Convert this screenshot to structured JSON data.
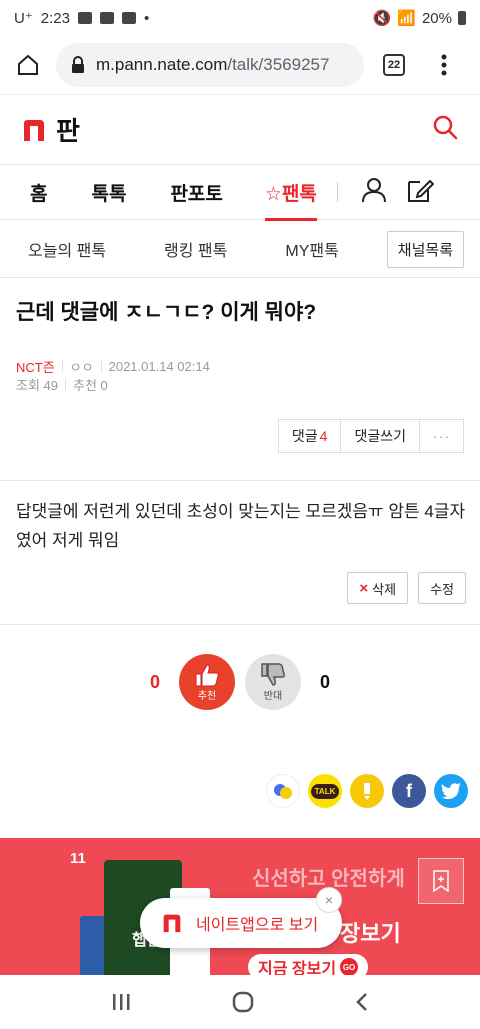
{
  "status_bar": {
    "carrier": "U⁺",
    "time": "2:23",
    "battery": "20%"
  },
  "browser": {
    "url_host": "m.pann.nate.com",
    "url_path": "/talk/3569257",
    "tab_count": "22"
  },
  "site": {
    "brand": "판",
    "accent_color": "#e8262b"
  },
  "main_nav": {
    "items": [
      "홈",
      "톡톡",
      "판포토",
      "☆팬톡"
    ],
    "active": "☆팬톡"
  },
  "sub_nav": {
    "items": [
      "오늘의 팬톡",
      "랭킹 팬톡",
      "MY팬톡"
    ],
    "channel_button": "채널목록"
  },
  "article": {
    "title": "근데 댓글에 ㅈㄴㄱㄷ? 이게 뭐야?",
    "author": "NCT즌",
    "writer": "ㅇㅇ",
    "date": "2021.01.14 02:14",
    "views_label": "조회 49",
    "recommend_label": "추천 0",
    "body": "답댓글에 저런게 있던데 초성이 맞는지는 모르겠음ㅠ 암튼 4글자였어 저게 뭐임"
  },
  "actions": {
    "comments_label": "댓글",
    "comments_count": "4",
    "write_comment": "댓글쓰기",
    "more": "···",
    "delete": "삭제",
    "delete_icon": "×",
    "edit": "수정"
  },
  "vote": {
    "up_count": "0",
    "up_label": "추천",
    "down_label": "반대",
    "down_count": "0"
  },
  "share": {
    "icons": [
      "nate-icon",
      "kakaotalk-icon",
      "kakaostory-icon",
      "facebook-icon",
      "twitter-icon"
    ],
    "talk_text": "TALK",
    "facebook_text": "f"
  },
  "ad": {
    "brand": "11",
    "headline_partial": "신선하고 안전하게",
    "headline_main": "장보기",
    "cta": "지금 장보기",
    "cta_go": "GO",
    "product_label": "햅쌀"
  },
  "app_banner": {
    "text": "네이트앱으로 보기",
    "close": "×"
  }
}
